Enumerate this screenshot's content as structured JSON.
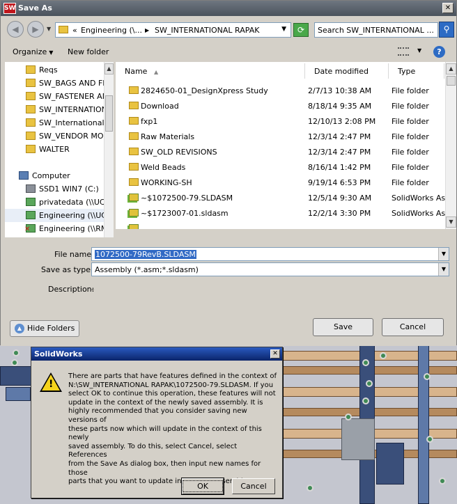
{
  "window": {
    "title": "Save As",
    "app_icon_text": "SW"
  },
  "address_bar": {
    "crumbs": [
      "Engineering (\\...",
      "SW_INTERNATIONAL RAPAK"
    ],
    "search_placeholder": "Search SW_INTERNATIONAL ..."
  },
  "toolbar": {
    "organize_label": "Organize",
    "new_folder_label": "New folder"
  },
  "nav_pane": {
    "items": [
      {
        "label": "Reqs",
        "icon": "folder-icon"
      },
      {
        "label": "SW_BAGS AND FIT",
        "icon": "folder-icon"
      },
      {
        "label": "SW_FASTENER AN",
        "icon": "folder-icon"
      },
      {
        "label": "SW_INTERNATION",
        "icon": "folder-icon"
      },
      {
        "label": "SW_International F",
        "icon": "folder-icon"
      },
      {
        "label": "SW_VENDOR MODE",
        "icon": "folder-icon"
      },
      {
        "label": "WALTER",
        "icon": "folder-icon"
      }
    ],
    "computer_label": "Computer",
    "drives": [
      {
        "label": "SSD1 WIN7  (C:)",
        "icon": "drive-icon"
      },
      {
        "label": "privatedata (\\\\UCF",
        "icon": "network-drive-icon"
      },
      {
        "label": "Engineering (\\\\UCF",
        "icon": "network-drive-icon"
      },
      {
        "label": "Engineering (\\\\RMC",
        "icon": "disconnected-network-drive-icon"
      }
    ]
  },
  "file_list": {
    "columns": [
      "Name",
      "Date modified",
      "Type"
    ],
    "rows": [
      {
        "name": "2824650-01_DesignXpress Study",
        "date": "2/7/13 10:38 AM",
        "type": "File folder",
        "icon": "folder-icon"
      },
      {
        "name": "Download",
        "date": "8/18/14 9:35 AM",
        "type": "File folder",
        "icon": "folder-icon"
      },
      {
        "name": "fxp1",
        "date": "12/10/13 2:08 PM",
        "type": "File folder",
        "icon": "folder-icon"
      },
      {
        "name": "Raw Materials",
        "date": "12/3/14 2:47 PM",
        "type": "File folder",
        "icon": "folder-icon"
      },
      {
        "name": "SW_OLD REVISIONS",
        "date": "12/3/14 2:47 PM",
        "type": "File folder",
        "icon": "folder-icon"
      },
      {
        "name": "Weld Beads",
        "date": "8/16/14 1:42 PM",
        "type": "File folder",
        "icon": "folder-icon"
      },
      {
        "name": "WORKING-SH",
        "date": "9/19/14 6:53 PM",
        "type": "File folder",
        "icon": "folder-icon"
      },
      {
        "name": "~$1072500-79.SLDASM",
        "date": "12/5/14 9:30 AM",
        "type": "SolidWorks Asse",
        "icon": "assembly-file-icon"
      },
      {
        "name": "~$1723007-01.sldasm",
        "date": "12/2/14 3:30 PM",
        "type": "SolidWorks Asse",
        "icon": "assembly-file-icon"
      }
    ]
  },
  "save_form": {
    "file_name_label": "File name:",
    "file_name_value": "1072500-79RevB.SLDASM",
    "save_as_type_label": "Save as type:",
    "save_as_type_value": "Assembly (*.asm;*.sldasm)",
    "description_label": "Description:",
    "description_value": "-",
    "hide_folders_label": "Hide Folders",
    "save_label": "Save",
    "cancel_label": "Cancel"
  },
  "message_box": {
    "title": "SolidWorks",
    "text": "There are parts that have features defined in the context of\nN:\\SW_INTERNATIONAL RAPAK\\1072500-79.SLDASM.  If you\nselect OK to continue this operation, these features will not\nupdate in the context of the newly saved assembly. It is\nhighly recommended that you consider saving new versions of\nthese parts now which will update in the context of this newly\nsaved assembly.  To do this, select Cancel, select References\nfrom the Save As dialog box, then input new names for those\nparts that you want to update in the new assembly.",
    "ok_label": "OK",
    "cancel_label": "Cancel"
  },
  "colors": {
    "selection": "#316ac5",
    "message_title": "#0a246a",
    "folder": "#e9c341"
  }
}
